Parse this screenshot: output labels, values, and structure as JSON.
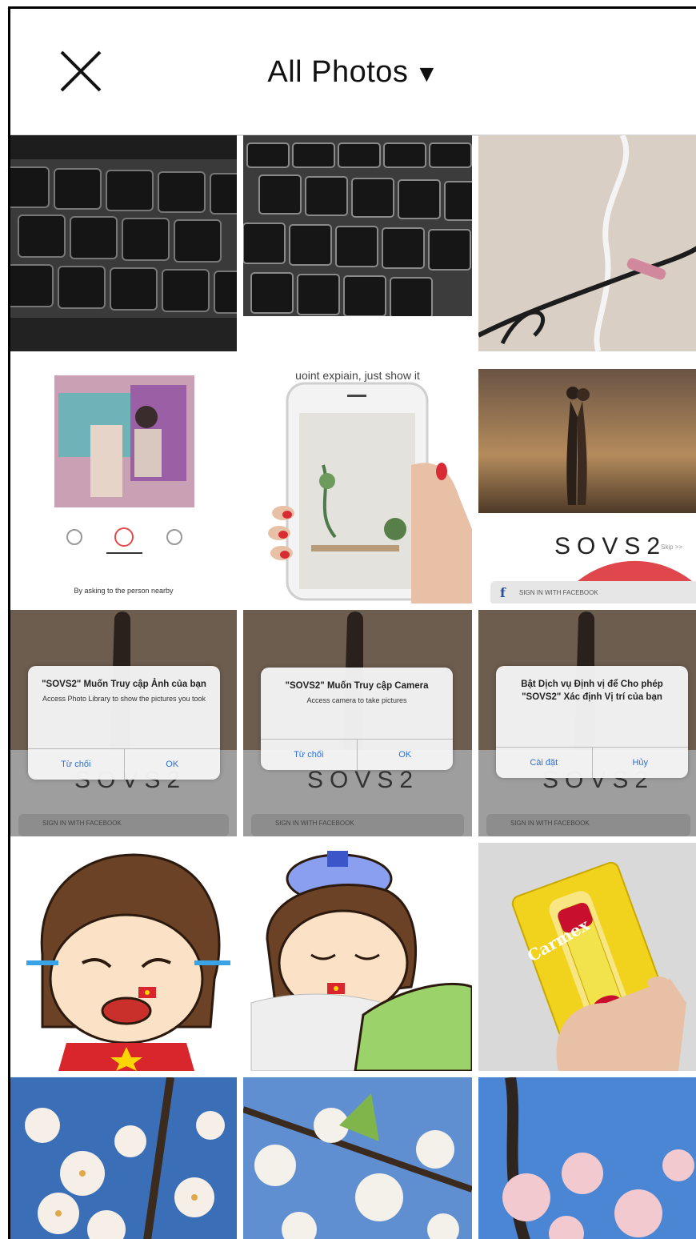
{
  "header": {
    "title": "All Photos",
    "caret": "▼",
    "close_icon": "close-icon"
  },
  "tiles": {
    "t4_caption": "By asking to the person nearby",
    "t5_caption": "uoint expiain, just show it",
    "t6_brand": "SOVS2",
    "t6_skip": "Skip >>",
    "t6_fb": "SIGN IN WITH FACEBOOK",
    "d1": {
      "msg": "\"SOVS2\" Muốn Truy cập Ảnh của bạn",
      "sub": "Access Photo Library to show the pictures you took",
      "btn1": "Từ chối",
      "btn2": "OK"
    },
    "d2": {
      "msg": "\"SOVS2\" Muốn Truy cập Camera",
      "sub": "Access camera to take pictures",
      "btn1": "Từ chối",
      "btn2": "OK"
    },
    "d3": {
      "msg": "Bật Dịch vụ Định vị để Cho phép \"SOVS2\" Xác định Vị trí của bạn",
      "sub": "",
      "btn1": "Cài đặt",
      "btn2": "Hủy"
    },
    "brand_under": "SOVS2",
    "fb_under": "SIGN IN WITH FACEBOOK",
    "carmex": "Carmex"
  },
  "colors": {
    "keyboard": "#2b2b2b",
    "sunset": "#8a6a48",
    "sky": "#3a7fd0",
    "blossom": "#f4ecef",
    "carmex_yellow": "#f1d21c",
    "carmex_red": "#c8102e"
  }
}
